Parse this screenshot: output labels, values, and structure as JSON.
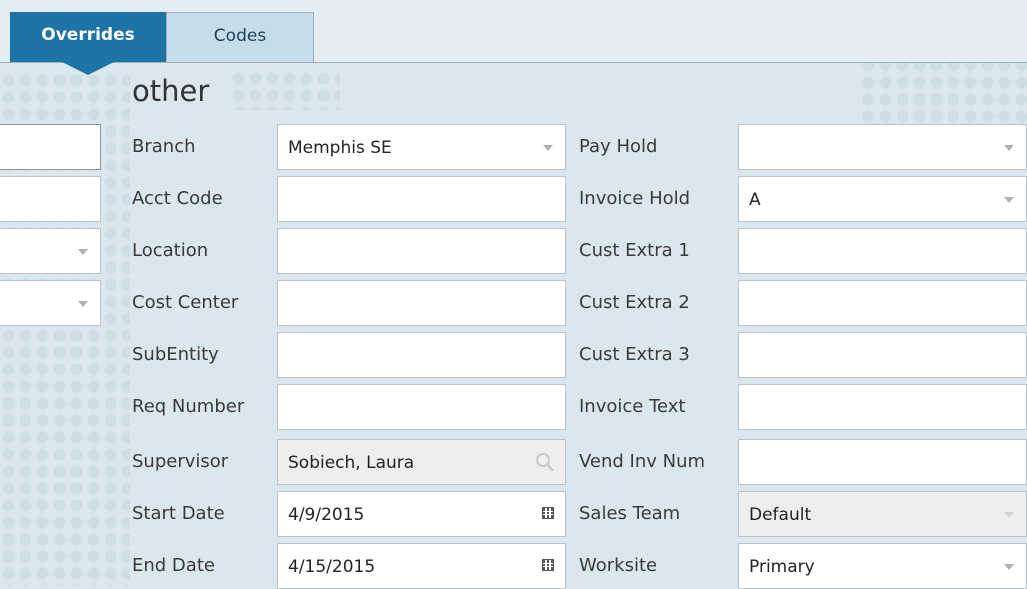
{
  "tabs": [
    {
      "label": "Overrides",
      "active": true
    },
    {
      "label": "Codes",
      "active": false
    }
  ],
  "section_title": "other",
  "left_fields": [
    {
      "label": "Branch",
      "value": "Memphis SE",
      "control": "dropdown"
    },
    {
      "label": "Acct Code",
      "value": "",
      "control": "text"
    },
    {
      "label": "Location",
      "value": "",
      "control": "text"
    },
    {
      "label": "Cost Center",
      "value": "",
      "control": "text"
    },
    {
      "label": "SubEntity",
      "value": "",
      "control": "text"
    },
    {
      "label": "Req Number",
      "value": "",
      "control": "text"
    },
    {
      "label": "Supervisor",
      "value": "Sobiech, Laura",
      "control": "search",
      "icon": "search-icon"
    },
    {
      "label": "Start Date",
      "value": "4/9/2015",
      "control": "date",
      "icon": "calendar-icon"
    },
    {
      "label": "End Date",
      "value": "4/15/2015",
      "control": "date",
      "icon": "calendar-icon"
    }
  ],
  "right_fields": [
    {
      "label": "Pay Hold",
      "value": "",
      "control": "dropdown"
    },
    {
      "label": "Invoice Hold",
      "value": "A",
      "control": "dropdown"
    },
    {
      "label": "Cust Extra 1",
      "value": "",
      "control": "text"
    },
    {
      "label": "Cust Extra 2",
      "value": "",
      "control": "text"
    },
    {
      "label": "Cust Extra 3",
      "value": "",
      "control": "text"
    },
    {
      "label": "Invoice Text",
      "value": "",
      "control": "text"
    },
    {
      "label": "Vend Inv Num",
      "value": "",
      "control": "text"
    },
    {
      "label": "Sales Team",
      "value": "Default",
      "control": "dropdown-disabled"
    },
    {
      "label": "Worksite",
      "value": "Primary",
      "control": "dropdown"
    }
  ],
  "colors": {
    "active_tab": "#1d72a6",
    "inactive_tab": "#c6dcea",
    "background": "#dbe7ee"
  }
}
